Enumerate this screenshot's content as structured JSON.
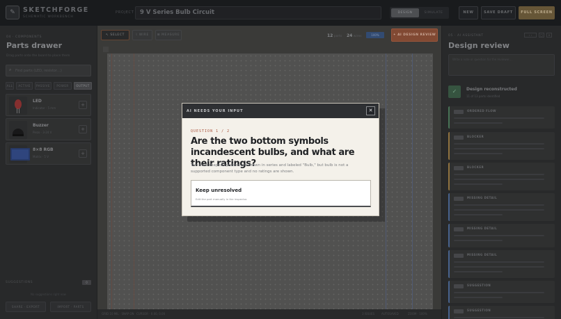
{
  "app": {
    "brand": "SKETCHFORGE",
    "brand_sub": "SCHEMATIC WORKBENCH",
    "logo_icon": "✎",
    "project_label": "PROJECT",
    "project_title": "9 V Series Bulb Circuit",
    "mode_tabs": [
      "DESIGN",
      "SIMULATE"
    ],
    "active_mode": "DESIGN",
    "buttons": {
      "new": "NEW",
      "save": "SAVE DRAFT",
      "full": "FULL SCREEN"
    }
  },
  "parts_drawer": {
    "crumb": "04 · COMPONENTS",
    "title": "Parts drawer",
    "subtitle": "Drag parts onto the board to place them",
    "search_placeholder": "Find parts (LED, resistor…)",
    "filters": [
      "ALL",
      "ACTIVE",
      "PASSIVE",
      "POWER",
      "OUTPUT"
    ],
    "active_filter": "OUTPUT",
    "parts": [
      {
        "name": "LED",
        "meta": "Indicator · 5 mm"
      },
      {
        "name": "Buzzer",
        "meta": "Piezo · 3-24 V"
      },
      {
        "name": "8×8 RGB",
        "meta": "Matrix · 5 V"
      }
    ],
    "assist_label": "SUGGESTIONS",
    "assist_count": "0",
    "assist_hint": "No suggestions right now",
    "footer_buttons": [
      "SHARE · EXPORT",
      "IMPORT · PARTS"
    ]
  },
  "canvas": {
    "tools": [
      "SELECT",
      "WIRE",
      "MEASURE"
    ],
    "active_tool": "SELECT",
    "stats": [
      {
        "value": "12",
        "label": "parts"
      },
      {
        "value": "24",
        "label": "wires"
      }
    ],
    "zoom": "100%",
    "review_button": "AI DESIGN REVIEW",
    "status": [
      "GRID 10 MIL · SNAP ON",
      "CURSOR · 0.00, 0.00",
      "3 ISSUES",
      "AUTOSAVED",
      "ZOOM · 100%"
    ]
  },
  "design_review": {
    "crumb": "05 · AI ASSISTANT",
    "title": "Design review",
    "notes_placeholder": "Write a note or question for the reviewer…",
    "reconstructed_title": "Design reconstructed",
    "reconstructed_sub": "11 of 13 parts identified",
    "cards": [
      {
        "head": "ORDERED FLOW",
        "color": "#4d7a5c"
      },
      {
        "head": "BLOCKER",
        "color": "#9a7a45"
      },
      {
        "head": "BLOCKER",
        "color": "#9a7a45"
      },
      {
        "head": "MISSING DETAIL",
        "color": "#4d6a96"
      },
      {
        "head": "MISSING DETAIL",
        "color": "#4d6a96"
      },
      {
        "head": "MISSING DETAIL",
        "color": "#4d6a96"
      },
      {
        "head": "SUGGESTION",
        "color": "#4d6a96"
      },
      {
        "head": "SUGGESTION",
        "color": "#4d6a96"
      }
    ]
  },
  "modal": {
    "header": "AI NEEDS YOUR INPUT",
    "close_icon": "✕",
    "counter": "QUESTION 1 / 2",
    "question": "Are the two bottom symbols incandescent bulbs, and what are their ratings?",
    "body": "Two bulb-shaped symbols are drawn in series and labeled \"Bulb,\" but bulb is not a supported component type and no ratings are shown.",
    "option_title": "Keep unresolved",
    "option_sub": "Edit the part manually in the inspector."
  },
  "colors": {
    "accent": "#a8513a",
    "primary_button": "#6d5c3b",
    "review_button": "#8a4e37",
    "modal_bg": "#f4f1ea"
  }
}
